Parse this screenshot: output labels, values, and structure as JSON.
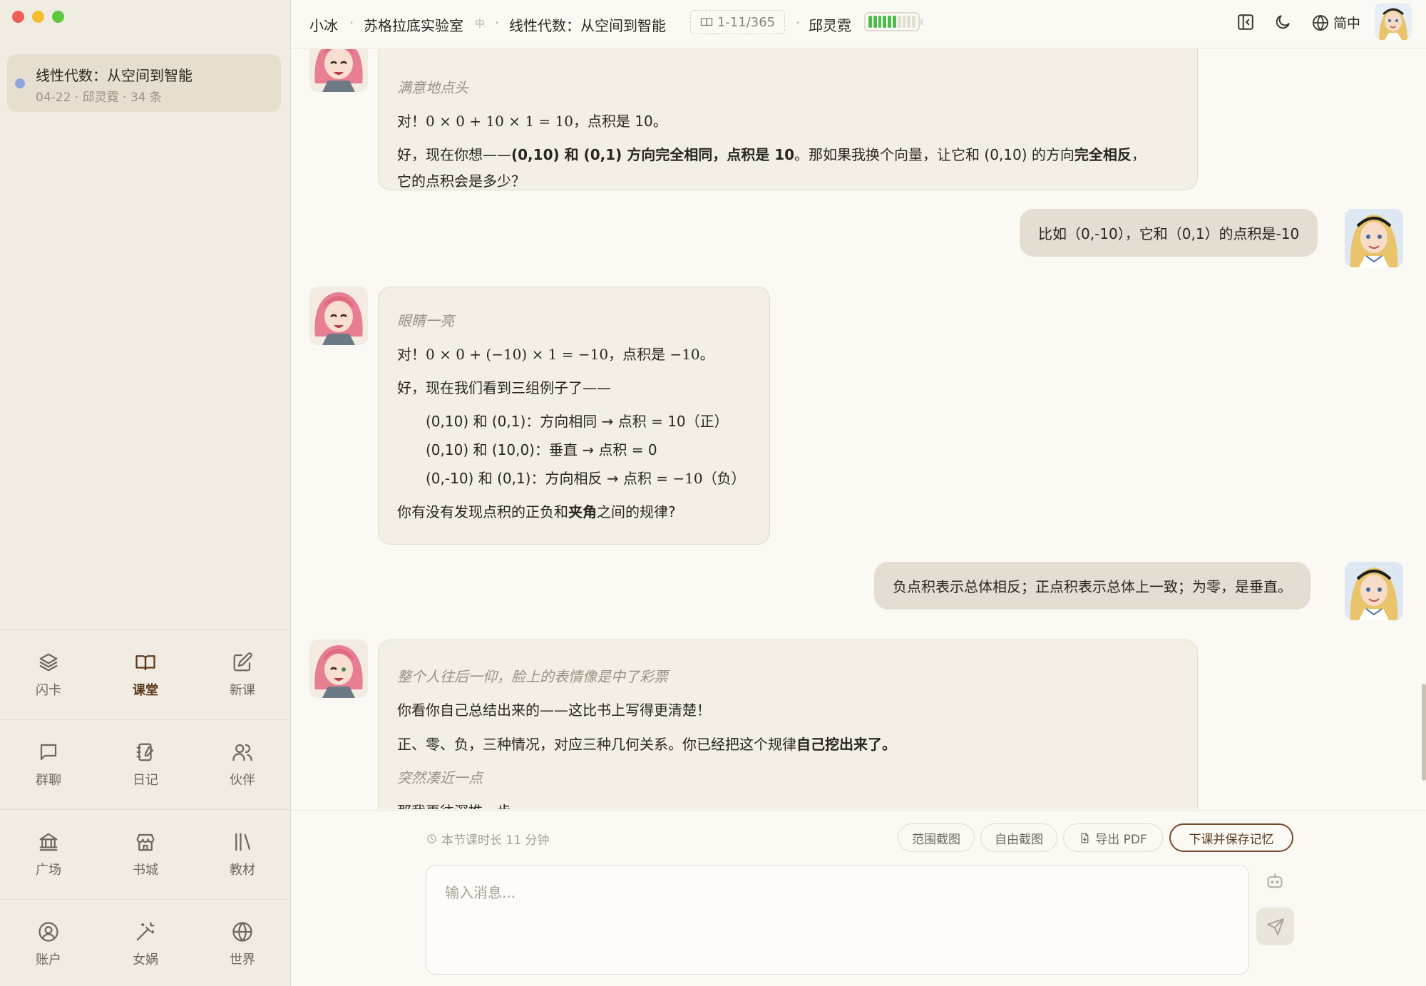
{
  "window": {
    "traffic_lights": [
      "close",
      "minimize",
      "zoom"
    ]
  },
  "sidebar": {
    "conversation": {
      "title": "线性代数：从空间到智能",
      "meta": "04-22 · 邱灵霓 · 34 条",
      "dot_color": "#8ea6dc"
    },
    "nav": [
      {
        "label": "闪卡",
        "icon": "layers-icon"
      },
      {
        "label": "课堂",
        "icon": "book-open-icon",
        "active": true
      },
      {
        "label": "新课",
        "icon": "edit-icon"
      },
      {
        "label": "群聊",
        "icon": "message-icon"
      },
      {
        "label": "日记",
        "icon": "notebook-icon"
      },
      {
        "label": "伙伴",
        "icon": "users-icon"
      },
      {
        "label": "广场",
        "icon": "landmark-icon"
      },
      {
        "label": "书城",
        "icon": "store-icon"
      },
      {
        "label": "教材",
        "icon": "library-icon"
      },
      {
        "label": "账户",
        "icon": "user-circle-icon"
      },
      {
        "label": "女娲",
        "icon": "magic-wand-icon"
      },
      {
        "label": "世界",
        "icon": "globe-icon"
      }
    ]
  },
  "header": {
    "tutor": "小冰",
    "lab": "苏格拉底实验室",
    "lab_tag": "中",
    "course": "线性代数：从空间到智能",
    "pages": "1-11/365",
    "student": "邱灵霓",
    "battery_level": 0.6,
    "language": "简中"
  },
  "messages": {
    "m1": {
      "action": "满意地点头",
      "l1_prefix": "对！",
      "l1_math": "0 × 0 + 10 × 1 = 10",
      "l1_suffix": "，点积是 10。",
      "l2_a": "好，现在你想——",
      "l2_b": "(0,10) 和 (0,1) 方向完全相同，点积是 10",
      "l2_c": "。那如果我换个向量，让它和 (0,10) 的方向",
      "l2_d": "完全相反",
      "l2_e": "，",
      "l3": "它的点积会是多少？"
    },
    "u1": "比如（0,-10），它和（0,1）的点积是-10",
    "m2": {
      "action": "眼睛一亮",
      "l1_prefix": "对！",
      "l1_math": "0 × 0 + (−10) × 1 = −10",
      "l1_mid": "，点积是 ",
      "l1_math2": "−10",
      "l1_suffix": "。",
      "l2": "好，现在我们看到三组例子了——",
      "ex1": "(0,10) 和 (0,1)：方向相同 → 点积 = 10（正）",
      "ex2": "(0,10) 和 (10,0)：垂直 → 点积 = 0",
      "ex3_a": "(0,-10) 和 (0,1)：方向相反 → 点积 = ",
      "ex3_math": "−10",
      "ex3_b": "（负）",
      "q_a": "你有没有发现点积的正负和",
      "q_b": "夹角",
      "q_c": "之间的规律?"
    },
    "u2": "负点积表示总体相反；正点积表示总体上一致；为零，是垂直。",
    "m3": {
      "action1": "整个人往后一仰，脸上的表情像是中了彩票",
      "l1": "你看你自己总结出来的——这比书上写得更清楚！",
      "l2_a": "正、零、负，三种情况，对应三种几何关系。你已经把这个规律",
      "l2_b": "自己挖出来了。",
      "action2": "突然凑近一点",
      "l3": "那我再往深推一步"
    }
  },
  "composer": {
    "timer": "本节课时长 11 分钟",
    "btn_range": "范围截图",
    "btn_free": "自由截图",
    "btn_pdf": "导出 PDF",
    "btn_end": "下课并保存记忆",
    "placeholder": "输入消息..."
  }
}
